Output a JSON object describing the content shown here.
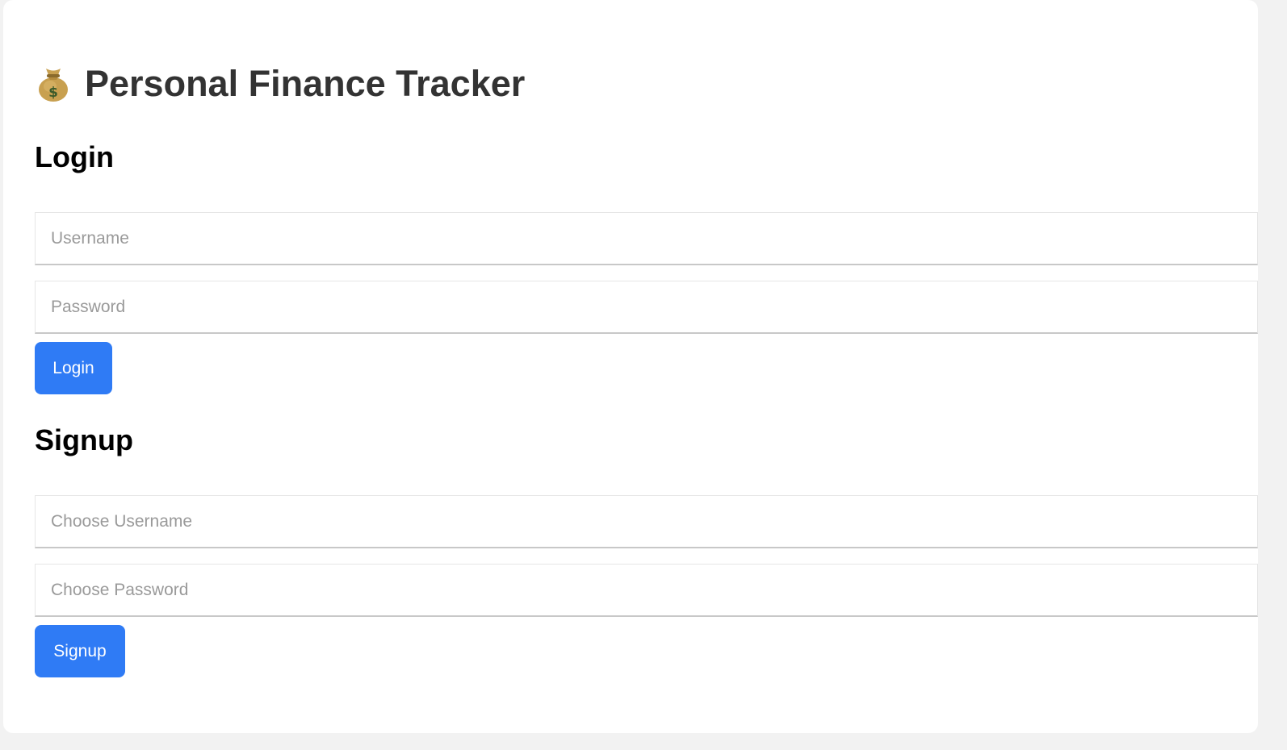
{
  "app": {
    "title": "Personal Finance Tracker",
    "icon": "money-bag-icon"
  },
  "login": {
    "heading": "Login",
    "username_placeholder": "Username",
    "password_placeholder": "Password",
    "button_label": "Login"
  },
  "signup": {
    "heading": "Signup",
    "username_placeholder": "Choose Username",
    "password_placeholder": "Choose Password",
    "button_label": "Signup"
  },
  "colors": {
    "primary_button": "#2f7bf5",
    "title_text": "#333333",
    "page_background": "#f2f2f2",
    "card_background": "#ffffff"
  }
}
